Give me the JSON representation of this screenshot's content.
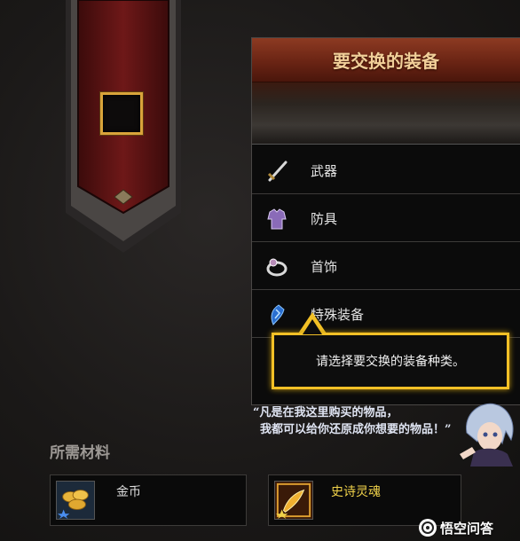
{
  "equipment_panel": {
    "title": "要交换的装备",
    "items": [
      {
        "label": "武器",
        "icon": "sword-icon"
      },
      {
        "label": "防具",
        "icon": "armor-icon"
      },
      {
        "label": "首饰",
        "icon": "ring-icon"
      },
      {
        "label": "特殊装备",
        "icon": "special-gem-icon"
      }
    ]
  },
  "tooltip": {
    "text": "请选择要交换的装备种类。"
  },
  "npc_quote": {
    "line1": "“凡是在我这里购买的物品，",
    "line2": "我都可以给你还原成你想要的物品！”"
  },
  "materials": {
    "title": "所需材料",
    "items": [
      {
        "label": "金币",
        "icon": "gold-coins-icon",
        "color": "#e6e6e6"
      },
      {
        "label": "史诗灵魂",
        "icon": "epic-soul-icon",
        "color": "#f0d24a"
      }
    ]
  },
  "watermark": {
    "text": "悟空问答"
  },
  "colors": {
    "accent_gold": "#f2c026",
    "header_red": "#6a2414",
    "title_text": "#f1cf99",
    "epic_yellow": "#f0d24a"
  }
}
